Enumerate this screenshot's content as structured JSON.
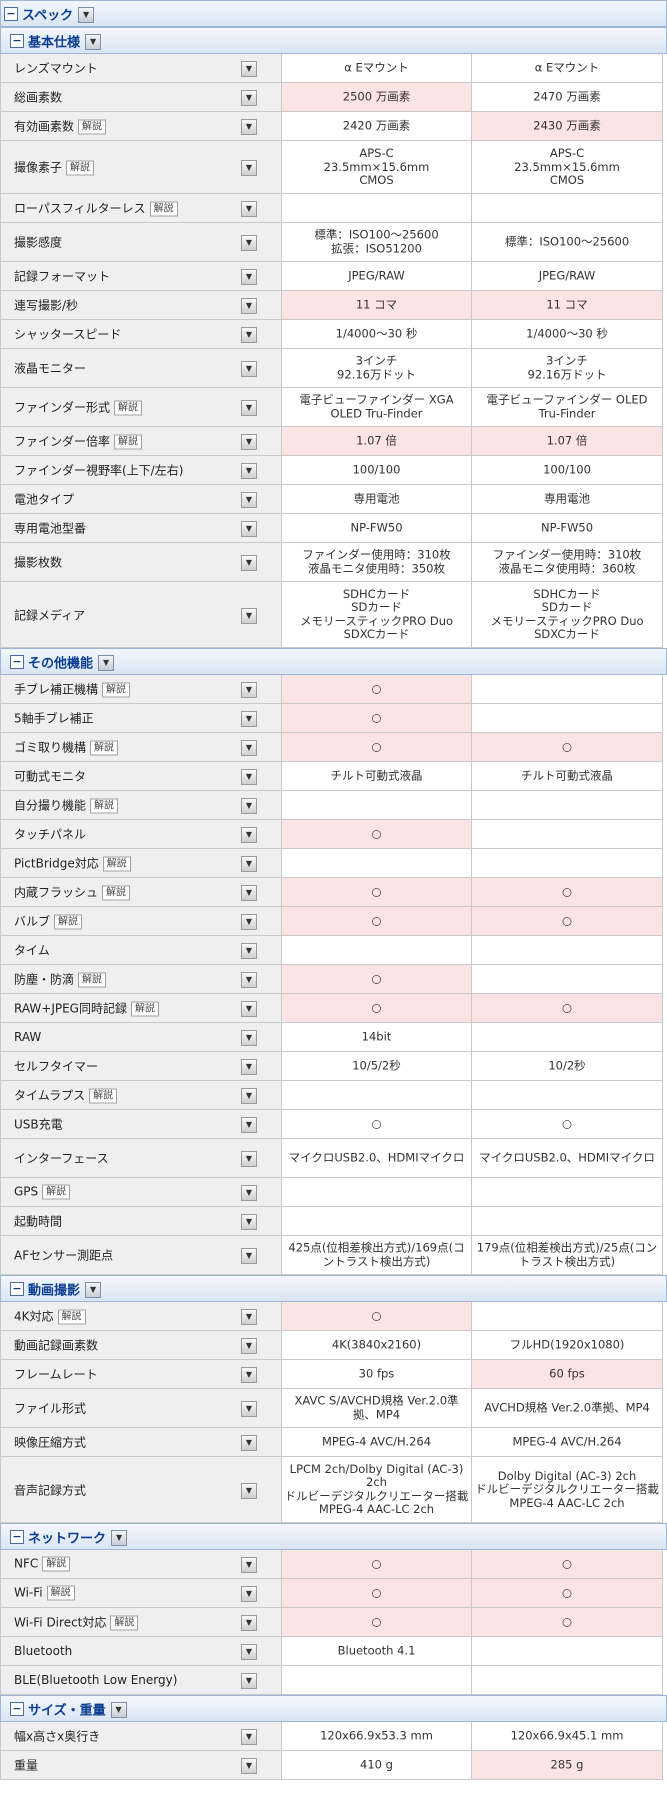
{
  "symbols": {
    "minus": "−",
    "dropdown": "▼",
    "maru": "○"
  },
  "sections": [
    {
      "title": "スペック",
      "level": 0,
      "rows": []
    },
    {
      "title": "基本仕様",
      "level": 1,
      "rows": [
        {
          "label": "レンズマウント",
          "v1": "α Eマウント",
          "v2": "α Eマウント"
        },
        {
          "label": "総画素数",
          "v1": "2500 万画素",
          "v2": "2470 万画素",
          "p1": true
        },
        {
          "label": "有効画素数",
          "badge": "解説",
          "v1": "2420 万画素",
          "v2": "2430 万画素",
          "p2": true
        },
        {
          "label": "撮像素子",
          "badge": "解説",
          "v1": "APS-C\n23.5mm×15.6mm\nCMOS",
          "v2": "APS-C\n23.5mm×15.6mm\nCMOS"
        },
        {
          "label": "ローパスフィルターレス",
          "badge": "解説",
          "v1": "",
          "v2": ""
        },
        {
          "label": "撮影感度",
          "v1": "標準：ISO100～25600\n拡張：ISO51200",
          "v2": "標準：ISO100～25600"
        },
        {
          "label": "記録フォーマット",
          "v1": "JPEG/RAW",
          "v2": "JPEG/RAW"
        },
        {
          "label": "連写撮影/秒",
          "v1": "11 コマ",
          "v2": "11 コマ",
          "p1": true,
          "p2": true
        },
        {
          "label": "シャッタースピード",
          "v1": "1/4000～30 秒",
          "v2": "1/4000～30 秒"
        },
        {
          "label": "液晶モニター",
          "v1": "3インチ\n92.16万ドット",
          "v2": "3インチ\n92.16万ドット"
        },
        {
          "label": "ファインダー形式",
          "badge": "解説",
          "v1": "電子ビューファインダー XGA OLED Tru-Finder",
          "v2": "電子ビューファインダー OLED Tru-Finder"
        },
        {
          "label": "ファインダー倍率",
          "badge": "解説",
          "v1": "1.07 倍",
          "v2": "1.07 倍",
          "p1": true,
          "p2": true
        },
        {
          "label": "ファインダー視野率(上下/左右)",
          "v1": "100/100",
          "v2": "100/100"
        },
        {
          "label": "電池タイプ",
          "v1": "専用電池",
          "v2": "専用電池"
        },
        {
          "label": "専用電池型番",
          "v1": "NP-FW50",
          "v2": "NP-FW50"
        },
        {
          "label": "撮影枚数",
          "v1": "ファインダー使用時：310枚\n液晶モニタ使用時：350枚",
          "v2": "ファインダー使用時：310枚\n液晶モニタ使用時：360枚"
        },
        {
          "label": "記録メディア",
          "v1": "SDHCカード\nSDカード\nメモリースティックPRO Duo\nSDXCカード",
          "v2": "SDHCカード\nSDカード\nメモリースティックPRO Duo\nSDXCカード"
        }
      ]
    },
    {
      "title": "その他機能",
      "level": 1,
      "rows": [
        {
          "label": "手ブレ補正機構",
          "badge": "解説",
          "v1": "○",
          "v2": "",
          "p1": true
        },
        {
          "label": "5軸手ブレ補正",
          "v1": "○",
          "v2": "",
          "p1": true
        },
        {
          "label": "ゴミ取り機構",
          "badge": "解説",
          "v1": "○",
          "v2": "○",
          "p1": true,
          "p2": true
        },
        {
          "label": "可動式モニタ",
          "v1": "チルト可動式液晶",
          "v2": "チルト可動式液晶"
        },
        {
          "label": "自分撮り機能",
          "badge": "解説",
          "v1": "",
          "v2": ""
        },
        {
          "label": "タッチパネル",
          "v1": "○",
          "v2": "",
          "p1": true
        },
        {
          "label": "PictBridge対応",
          "badge": "解説",
          "v1": "",
          "v2": ""
        },
        {
          "label": "内蔵フラッシュ",
          "badge": "解説",
          "v1": "○",
          "v2": "○",
          "p1": true,
          "p2": true
        },
        {
          "label": "バルブ",
          "badge": "解説",
          "v1": "○",
          "v2": "○",
          "p1": true,
          "p2": true
        },
        {
          "label": "タイム",
          "v1": "",
          "v2": ""
        },
        {
          "label": "防塵・防滴",
          "badge": "解説",
          "v1": "○",
          "v2": "",
          "p1": true
        },
        {
          "label": "RAW+JPEG同時記録",
          "badge": "解説",
          "v1": "○",
          "v2": "○",
          "p1": true,
          "p2": true
        },
        {
          "label": "RAW",
          "v1": "14bit",
          "v2": ""
        },
        {
          "label": "セルフタイマー",
          "v1": "10/5/2秒",
          "v2": "10/2秒"
        },
        {
          "label": "タイムラプス",
          "badge": "解説",
          "v1": "",
          "v2": ""
        },
        {
          "label": "USB充電",
          "v1": "○",
          "v2": "○"
        },
        {
          "label": "インターフェース",
          "v1": "マイクロUSB2.0、HDMIマイクロ",
          "v2": "マイクロUSB2.0、HDMIマイクロ"
        },
        {
          "label": "GPS",
          "badge": "解説",
          "v1": "",
          "v2": ""
        },
        {
          "label": "起動時間",
          "v1": "",
          "v2": ""
        },
        {
          "label": "AFセンサー測距点",
          "v1": "425点(位相差検出方式)/169点(コントラスト検出方式)",
          "v2": "179点(位相差検出方式)/25点(コントラスト検出方式)"
        }
      ]
    },
    {
      "title": "動画撮影",
      "level": 1,
      "rows": [
        {
          "label": "4K対応",
          "badge": "解説",
          "v1": "○",
          "v2": "",
          "p1": true
        },
        {
          "label": "動画記録画素数",
          "v1": "4K(3840x2160)",
          "v2": "フルHD(1920x1080)"
        },
        {
          "label": "フレームレート",
          "v1": "30 fps",
          "v2": "60 fps",
          "p2": true
        },
        {
          "label": "ファイル形式",
          "v1": "XAVC S/AVCHD規格 Ver.2.0準拠、MP4",
          "v2": "AVCHD規格 Ver.2.0準拠、MP4"
        },
        {
          "label": "映像圧縮方式",
          "v1": "MPEG-4 AVC/H.264",
          "v2": "MPEG-4 AVC/H.264"
        },
        {
          "label": "音声記録方式",
          "v1": "LPCM 2ch/Dolby Digital (AC-3) 2ch\nドルビーデジタルクリエーター搭載\nMPEG-4 AAC-LC 2ch",
          "v2": "Dolby Digital (AC-3) 2ch\nドルビーデジタルクリエーター搭載\nMPEG-4 AAC-LC 2ch"
        }
      ]
    },
    {
      "title": "ネットワーク",
      "level": 1,
      "rows": [
        {
          "label": "NFC",
          "badge": "解説",
          "v1": "○",
          "v2": "○",
          "p1": true,
          "p2": true
        },
        {
          "label": "Wi-Fi",
          "badge": "解説",
          "v1": "○",
          "v2": "○",
          "p1": true,
          "p2": true
        },
        {
          "label": "Wi-Fi Direct対応",
          "badge": "解説",
          "v1": "○",
          "v2": "○",
          "p1": true,
          "p2": true
        },
        {
          "label": "Bluetooth",
          "v1": "Bluetooth 4.1",
          "v2": ""
        },
        {
          "label": "BLE(Bluetooth Low Energy)",
          "v1": "",
          "v2": ""
        }
      ]
    },
    {
      "title": "サイズ・重量",
      "level": 1,
      "rows": [
        {
          "label": "幅x高さx奥行き",
          "v1": "120x66.9x53.3 mm",
          "v2": "120x66.9x45.1 mm"
        },
        {
          "label": "重量",
          "v1": "410 g",
          "v2": "285 g",
          "p2": true
        }
      ]
    }
  ]
}
